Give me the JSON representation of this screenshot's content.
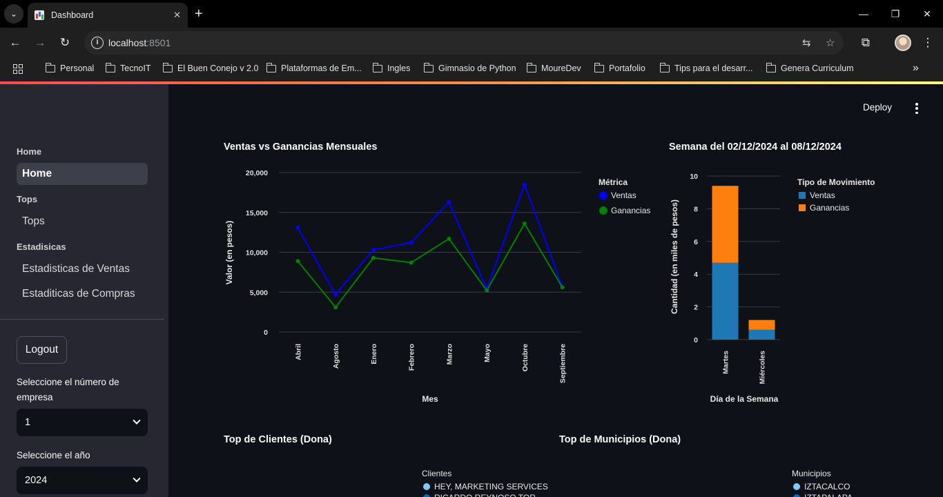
{
  "browser": {
    "tab_title": "Dashboard",
    "url_host": "localhost",
    "url_port": ":8501",
    "bookmarks": [
      "Personal",
      "TecnoIT",
      "El Buen Conejo v 2.0",
      "Plataformas de Em...",
      "Ingles",
      "Gimnasio de Python",
      "MoureDev",
      "Portafolio",
      "Tips para el desarr...",
      "Genera Curriculum"
    ]
  },
  "header": {
    "deploy_label": "Deploy"
  },
  "sidebar": {
    "sections": [
      {
        "title": "Home",
        "items": [
          "Home"
        ]
      },
      {
        "title": "Tops",
        "items": [
          "Tops"
        ]
      },
      {
        "title": "Estadisicas",
        "items": [
          "Estadisticas de Ventas",
          "Estaditicas de Compras"
        ]
      }
    ],
    "active_item": "Home",
    "logout_label": "Logout",
    "empresa_label": "Seleccione el número de empresa",
    "empresa_value": "1",
    "anio_label": "Seleccione el año",
    "anio_value": "2024"
  },
  "colors": {
    "ventas_line": "#0000ff",
    "ganancias_line": "#008000",
    "bar_ventas": "#1f77b4",
    "bar_ganancias": "#ff7f0e",
    "accent": "#ff4b4b"
  },
  "chart_data": [
    {
      "type": "line",
      "title": "Ventas vs Ganancias Mensuales",
      "xlabel": "Mes",
      "ylabel": "Valor (en pesos)",
      "categories": [
        "Abril",
        "Agosto",
        "Enero",
        "Febrero",
        "Marzo",
        "Mayo",
        "Octubre",
        "Septiembre"
      ],
      "yticks": [
        "0",
        "5,000",
        "10,000",
        "15,000",
        "20,000"
      ],
      "ylim": [
        0,
        20000
      ],
      "legend_title": "Métrica",
      "legend_position": "right",
      "series": [
        {
          "name": "Ventas",
          "values": [
            13100,
            4700,
            10300,
            11200,
            16300,
            5400,
            18500,
            5700
          ]
        },
        {
          "name": "Ganancias",
          "values": [
            8900,
            3100,
            9300,
            8700,
            11700,
            5200,
            13600,
            5600
          ]
        }
      ]
    },
    {
      "type": "bar",
      "stacked": true,
      "title": "Semana del 02/12/2024 al 08/12/2024",
      "xlabel": "Día de la Semana",
      "ylabel": "Cantidad (en miles de pesos)",
      "categories": [
        "Martes",
        "Miércoles"
      ],
      "yticks": [
        "0",
        "2",
        "4",
        "6",
        "8",
        "10"
      ],
      "ylim": [
        0,
        10
      ],
      "legend_title": "Tipo de Movimiento",
      "legend_position": "right",
      "series": [
        {
          "name": "Ventas",
          "values": [
            4.7,
            0.6
          ]
        },
        {
          "name": "Ganancias",
          "values": [
            4.7,
            0.6
          ]
        }
      ]
    },
    {
      "type": "pie",
      "title": "Top de Clientes (Dona)",
      "legend_title": "Clientes",
      "legend_position": "right",
      "labels": [
        "HEY, MARKETING SERVICES",
        "RICARDO REYNOSO TOR..."
      ]
    },
    {
      "type": "pie",
      "title": "Top de Municipios (Dona)",
      "legend_title": "Municipios",
      "legend_position": "right",
      "labels": [
        "IZTACALCO",
        "IZTAPALAPA"
      ]
    }
  ]
}
